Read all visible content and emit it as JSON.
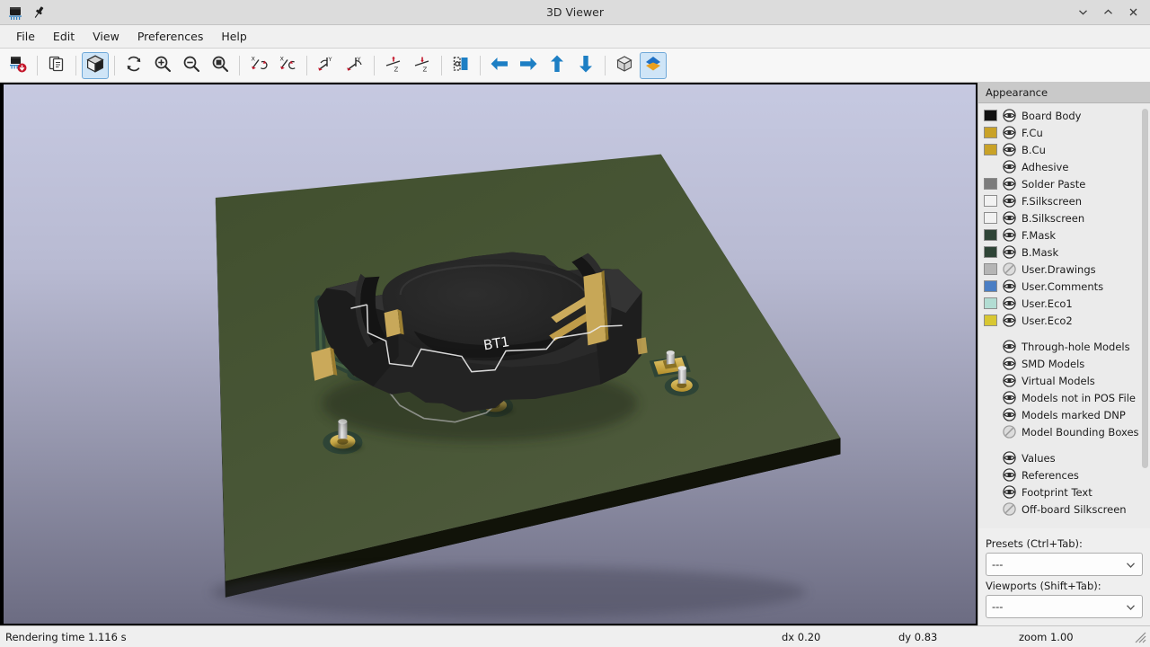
{
  "window": {
    "title": "3D Viewer",
    "icons": {
      "app": "pcb-icon",
      "pin": "pin-icon"
    },
    "controls": [
      {
        "name": "minimize-button",
        "glyph": "chevron-down"
      },
      {
        "name": "maximize-button",
        "glyph": "chevron-up"
      },
      {
        "name": "close-button",
        "glyph": "close"
      }
    ]
  },
  "menubar": {
    "items": [
      {
        "label": "File",
        "name": "menu-file"
      },
      {
        "label": "Edit",
        "name": "menu-edit"
      },
      {
        "label": "View",
        "name": "menu-view"
      },
      {
        "label": "Preferences",
        "name": "menu-preferences"
      },
      {
        "label": "Help",
        "name": "menu-help"
      }
    ]
  },
  "toolbar": {
    "groups": [
      {
        "buttons": [
          {
            "name": "reload-board-button",
            "icon": "reload-board-icon",
            "active": false
          }
        ]
      },
      {
        "buttons": [
          {
            "name": "copy-to-clipboard-button",
            "icon": "copy-icon",
            "active": false
          }
        ]
      },
      {
        "buttons": [
          {
            "name": "render-realistic-button",
            "icon": "cube-shaded-icon",
            "active": true
          }
        ]
      },
      {
        "buttons": [
          {
            "name": "refresh-button",
            "icon": "refresh-icon",
            "active": false
          },
          {
            "name": "zoom-in-button",
            "icon": "zoom-in-icon",
            "active": false
          },
          {
            "name": "zoom-out-button",
            "icon": "zoom-out-icon",
            "active": false
          },
          {
            "name": "zoom-fit-button",
            "icon": "zoom-fit-icon",
            "active": false
          }
        ]
      },
      {
        "buttons": [
          {
            "name": "rotate-x-clockwise-button",
            "icon": "rotate-x-cw-icon",
            "active": false
          },
          {
            "name": "rotate-x-counterclockwise-button",
            "icon": "rotate-x-ccw-icon",
            "active": false
          },
          {
            "name": "rotate-y-clockwise-button",
            "icon": "rotate-y-cw-icon",
            "active": false
          },
          {
            "name": "rotate-y-counterclockwise-button",
            "icon": "rotate-y-ccw-icon",
            "active": false
          },
          {
            "name": "rotate-z-clockwise-button",
            "icon": "rotate-z-cw-icon",
            "active": false
          },
          {
            "name": "rotate-z-counterclockwise-button",
            "icon": "rotate-z-ccw-icon",
            "active": false
          }
        ]
      },
      {
        "buttons": [
          {
            "name": "flip-board-button",
            "icon": "flip-board-icon",
            "active": false
          }
        ]
      },
      {
        "buttons": [
          {
            "name": "move-left-button",
            "icon": "arrow-left-icon",
            "active": false
          },
          {
            "name": "move-right-button",
            "icon": "arrow-right-icon",
            "active": false
          },
          {
            "name": "move-up-button",
            "icon": "arrow-up-icon",
            "active": false
          },
          {
            "name": "move-down-button",
            "icon": "arrow-down-icon",
            "active": false
          }
        ]
      },
      {
        "buttons": [
          {
            "name": "toggle-orthographic-button",
            "icon": "cube-wire-icon",
            "active": false
          },
          {
            "name": "toggle-raytracing-button",
            "icon": "raytrace-icon",
            "active": true
          }
        ]
      }
    ]
  },
  "appearance": {
    "header": "Appearance",
    "layers": [
      {
        "label": "Board Body",
        "color": "#111111",
        "visible": true,
        "name": "layer-board-body"
      },
      {
        "label": "F.Cu",
        "color": "#c9a227",
        "visible": true,
        "name": "layer-f-cu"
      },
      {
        "label": "B.Cu",
        "color": "#c9a227",
        "visible": true,
        "name": "layer-b-cu"
      },
      {
        "label": "Adhesive",
        "color": null,
        "visible": true,
        "name": "layer-adhesive"
      },
      {
        "label": "Solder Paste",
        "color": "#7c7c7c",
        "visible": true,
        "name": "layer-solder-paste"
      },
      {
        "label": "F.Silkscreen",
        "color": "#f2f2f2",
        "visible": true,
        "name": "layer-f-silkscreen"
      },
      {
        "label": "B.Silkscreen",
        "color": "#f2f2f2",
        "visible": true,
        "name": "layer-b-silkscreen"
      },
      {
        "label": "F.Mask",
        "color": "#2e4436",
        "visible": true,
        "name": "layer-f-mask"
      },
      {
        "label": "B.Mask",
        "color": "#2e4436",
        "visible": true,
        "name": "layer-b-mask"
      },
      {
        "label": "User.Drawings",
        "color": "#b5b5b5",
        "visible": false,
        "name": "layer-user-drawings"
      },
      {
        "label": "User.Comments",
        "color": "#4a7ec4",
        "visible": true,
        "name": "layer-user-comments"
      },
      {
        "label": "User.Eco1",
        "color": "#b2ddd3",
        "visible": true,
        "name": "layer-user-eco1"
      },
      {
        "label": "User.Eco2",
        "color": "#d8c732",
        "visible": true,
        "name": "layer-user-eco2"
      }
    ],
    "models": [
      {
        "label": "Through-hole Models",
        "visible": true,
        "name": "toggle-through-hole-models"
      },
      {
        "label": "SMD Models",
        "visible": true,
        "name": "toggle-smd-models"
      },
      {
        "label": "Virtual Models",
        "visible": true,
        "name": "toggle-virtual-models"
      },
      {
        "label": "Models not in POS File",
        "visible": true,
        "name": "toggle-models-not-in-pos-file"
      },
      {
        "label": "Models marked DNP",
        "visible": true,
        "name": "toggle-models-marked-dnp"
      },
      {
        "label": "Model Bounding Boxes",
        "visible": false,
        "name": "toggle-model-bounding-boxes"
      }
    ],
    "text_items": [
      {
        "label": "Values",
        "visible": true,
        "name": "toggle-values"
      },
      {
        "label": "References",
        "visible": true,
        "name": "toggle-references"
      },
      {
        "label": "Footprint Text",
        "visible": true,
        "name": "toggle-footprint-text"
      },
      {
        "label": "Off-board Silkscreen",
        "visible": false,
        "name": "toggle-off-board-silkscreen"
      }
    ],
    "presets": {
      "label": "Presets (Ctrl+Tab):",
      "value": "---"
    },
    "viewports": {
      "label": "Viewports (Shift+Tab):",
      "value": "---"
    }
  },
  "viewport": {
    "background_top": "#c6c9e1",
    "background_bottom": "#6c6c82",
    "board_color": "#3e4a2c",
    "board_edge_color": "#0d0f09",
    "pad_color": "#c9a227",
    "mask_color": "#2e4436",
    "component_color": "#232323",
    "silkscreen_color": "#f4f4f4",
    "reference_designator": "BT1",
    "description": "KiCad 3D render of a green PCB with a black coin-cell battery holder (BT1) and three through-hole pins plus a two-pad test point."
  },
  "statusbar": {
    "rendering_time": "Rendering time 1.116 s",
    "dx": "dx 0.20",
    "dy": "dy 0.83",
    "zoom": "zoom 1.00"
  }
}
